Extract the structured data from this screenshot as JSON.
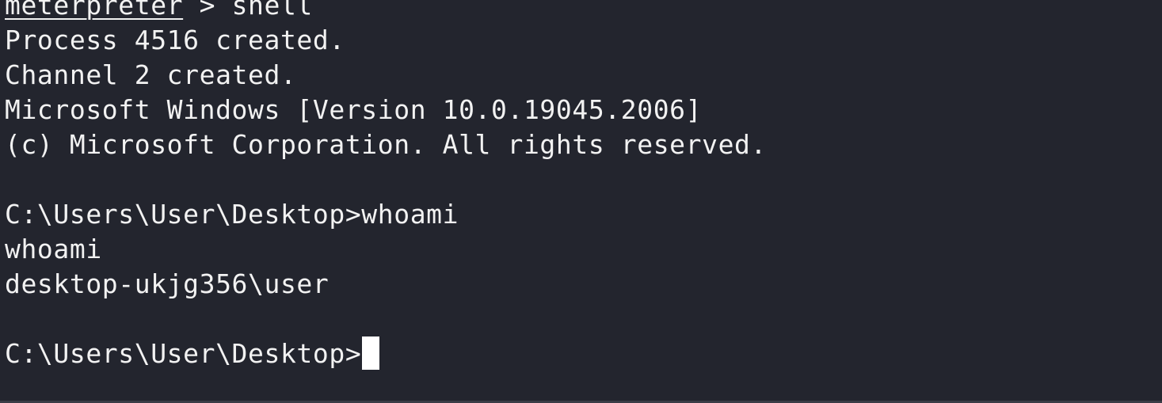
{
  "terminal": {
    "prompt_name": "meterpreter",
    "prompt_sep": " > ",
    "command": "shell",
    "lines": [
      "Process 4516 created.",
      "Channel 2 created.",
      "Microsoft Windows [Version 10.0.19045.2006]",
      "(c) Microsoft Corporation. All rights reserved.",
      "",
      "C:\\Users\\User\\Desktop>whoami",
      "whoami",
      "desktop-ukjg356\\user",
      ""
    ],
    "current_prompt": "C:\\Users\\User\\Desktop>",
    "colors": {
      "background": "#23252e",
      "text": "#f2f2f2",
      "cursor": "#ffffff"
    }
  }
}
